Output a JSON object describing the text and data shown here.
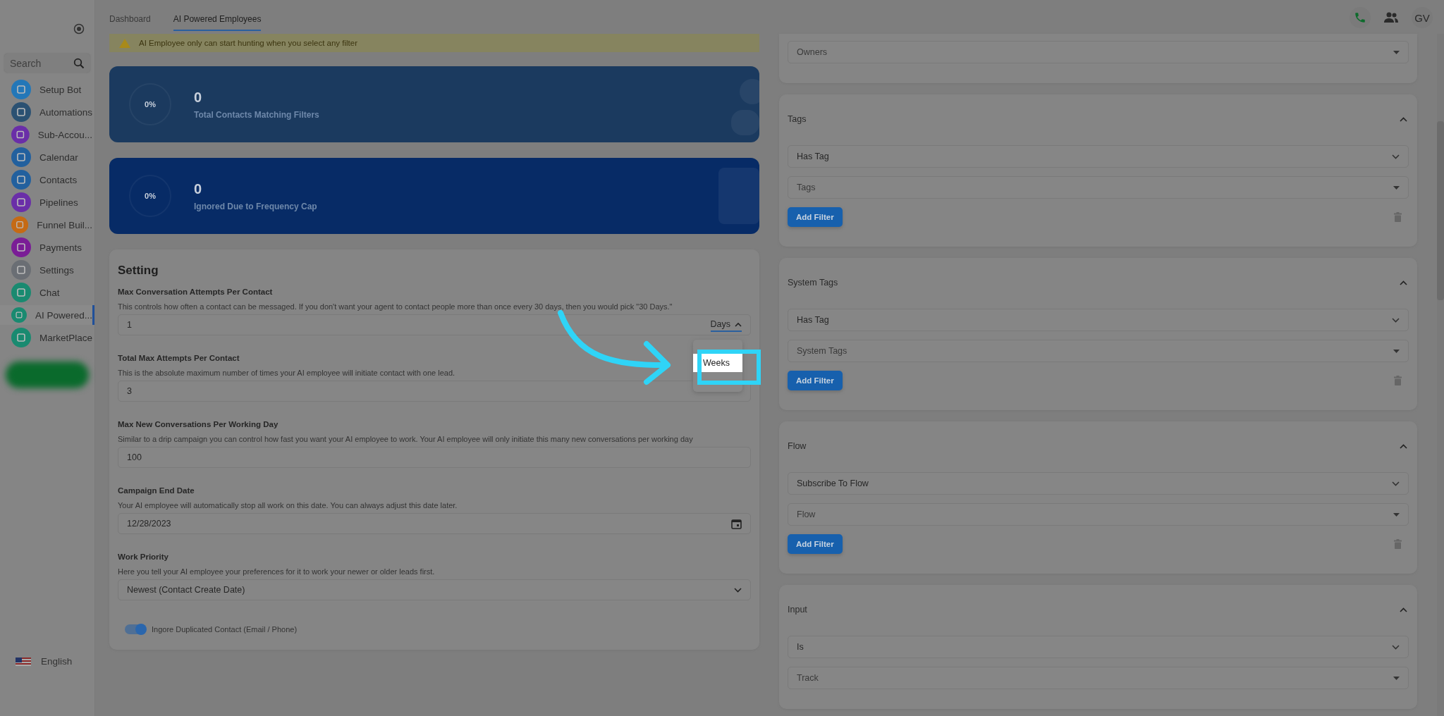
{
  "sidebar": {
    "search": {
      "placeholder": "Search"
    },
    "items": [
      {
        "label": "Setup Bot",
        "color": "#2377b8",
        "selected": false
      },
      {
        "label": "Automations",
        "color": "#2b5172",
        "selected": false
      },
      {
        "label": "Sub-Accou...",
        "color": "#6a2ea8",
        "selected": false
      },
      {
        "label": "Calendar",
        "color": "#22609e",
        "selected": false
      },
      {
        "label": "Contacts",
        "color": "#22609e",
        "selected": false
      },
      {
        "label": "Pipelines",
        "color": "#6a2ea8",
        "selected": false
      },
      {
        "label": "Funnel Buil...",
        "color": "#c56a14",
        "selected": false
      },
      {
        "label": "Payments",
        "color": "#7a1d96",
        "selected": false
      },
      {
        "label": "Settings",
        "color": "#6a6e74",
        "selected": false
      },
      {
        "label": "Chat",
        "color": "#198a70",
        "selected": false
      },
      {
        "label": "AI Powered...",
        "color": "#198a70",
        "selected": true
      },
      {
        "label": "MarketPlace",
        "color": "#198a70",
        "selected": false
      }
    ],
    "language": "English"
  },
  "tabs": [
    {
      "label": "Dashboard",
      "selected": false
    },
    {
      "label": "AI Powered Employees",
      "selected": true
    }
  ],
  "header": {
    "avatar": "GV"
  },
  "alert": "AI Employee only can start hunting when you select any filter",
  "stats": [
    {
      "kind": "contacts",
      "percent": "0%",
      "value": "0",
      "label": "Total Contacts Matching Filters"
    },
    {
      "kind": "ignored",
      "percent": "0%",
      "value": "0",
      "label": "Ignored Due to Frequency Cap"
    }
  ],
  "setting": {
    "title": "Setting",
    "fields": [
      {
        "kind": "number-unit",
        "label": "Max Conversation Attempts Per Contact",
        "description": "This controls how often a contact can be messaged. If you don't want your agent to contact people more than once every 30 days, then you would pick \"30 Days.\"",
        "value": "1",
        "unit": "Days",
        "menu": [
          {
            "label": "Weeks",
            "selected": true
          }
        ]
      },
      {
        "kind": "number",
        "label": "Total Max Attempts Per Contact",
        "description": "This is the absolute maximum number of times your AI employee will initiate contact with one lead.",
        "value": "3"
      },
      {
        "kind": "number",
        "label": "Max New Conversations Per Working Day",
        "description": "Similar to a drip campaign you can control how fast you want your AI employee to work. Your AI employee will only initiate this many new conversations per working day",
        "value": "100"
      },
      {
        "kind": "date",
        "label": "Campaign End Date",
        "description": "Your AI employee will automatically stop all work on this date. You can always adjust this date later.",
        "value": "12/28/2023"
      },
      {
        "kind": "select",
        "label": "Work Priority",
        "description": "Here you tell your AI employee your preferences for it to work your newer or older leads first.",
        "value": "Newest (Contact Create Date)"
      }
    ],
    "toggle": {
      "label": "Ingore Duplicated Contact (Email / Phone)",
      "on": true
    }
  },
  "filters": [
    {
      "selects": [
        {
          "kind": "placeholder",
          "text": "Owners"
        }
      ]
    },
    {
      "title": "Tags",
      "expanded": true,
      "selects": [
        {
          "kind": "value",
          "text": "Has Tag"
        },
        {
          "kind": "placeholder",
          "text": "Tags"
        }
      ],
      "button": "Add Filter"
    },
    {
      "title": "System Tags",
      "expanded": true,
      "selects": [
        {
          "kind": "value",
          "text": "Has Tag"
        },
        {
          "kind": "placeholder",
          "text": "System Tags"
        }
      ],
      "button": "Add Filter"
    },
    {
      "title": "Flow",
      "expanded": true,
      "selects": [
        {
          "kind": "value",
          "text": "Subscribe To Flow"
        },
        {
          "kind": "placeholder",
          "text": "Flow"
        }
      ],
      "button": "Add Filter"
    },
    {
      "title": "Input",
      "expanded": true,
      "selects": [
        {
          "kind": "value",
          "text": "Is"
        },
        {
          "kind": "placeholder",
          "text": "Track"
        }
      ]
    }
  ]
}
